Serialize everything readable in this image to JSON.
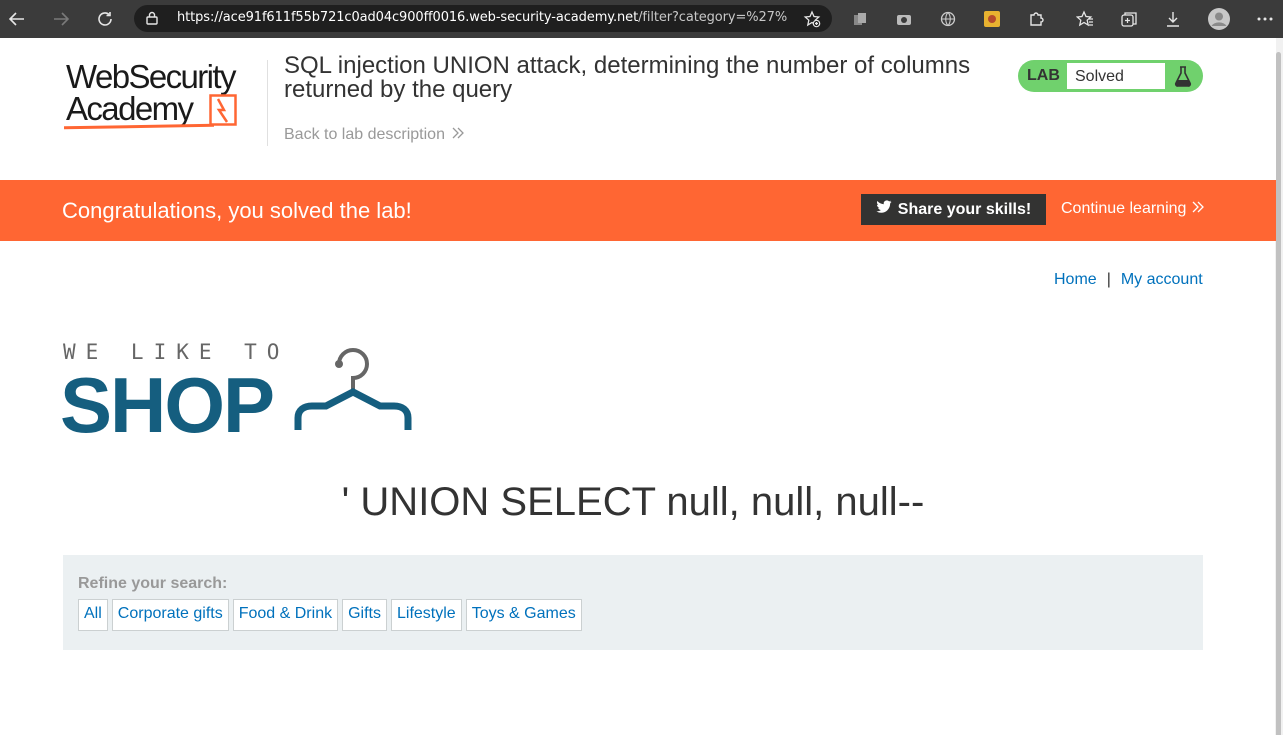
{
  "browser": {
    "url_host": "https://ace91f611f55b721c0ad04c900ff0016.web-security-academy.net",
    "url_path": "/filter?category=%27%20..."
  },
  "academy": {
    "logo_line1": "WebSecurity",
    "logo_line2": "Academy",
    "lab_title": "SQL injection UNION attack, determining the number of columns returned by the query",
    "back_link": "Back to lab description",
    "status_tag": "LAB",
    "status_value": "Solved"
  },
  "banner": {
    "message": "Congratulations, you solved the lab!",
    "share_label": "Share your skills!",
    "continue_label": "Continue learning"
  },
  "nav": {
    "home": "Home",
    "separator": "|",
    "account": "My account"
  },
  "shop": {
    "tagline": "WE LIKE TO",
    "name": "SHOP"
  },
  "page": {
    "heading": "' UNION SELECT null, null, null--"
  },
  "filter": {
    "label": "Refine your search:",
    "categories": [
      "All",
      "Corporate gifts",
      "Food & Drink",
      "Gifts",
      "Lifestyle",
      "Toys & Games"
    ]
  },
  "colors": {
    "accent": "#ff6633",
    "link": "#0071bc",
    "solved_green": "#70d16d",
    "shop_blue": "#155e7f"
  }
}
